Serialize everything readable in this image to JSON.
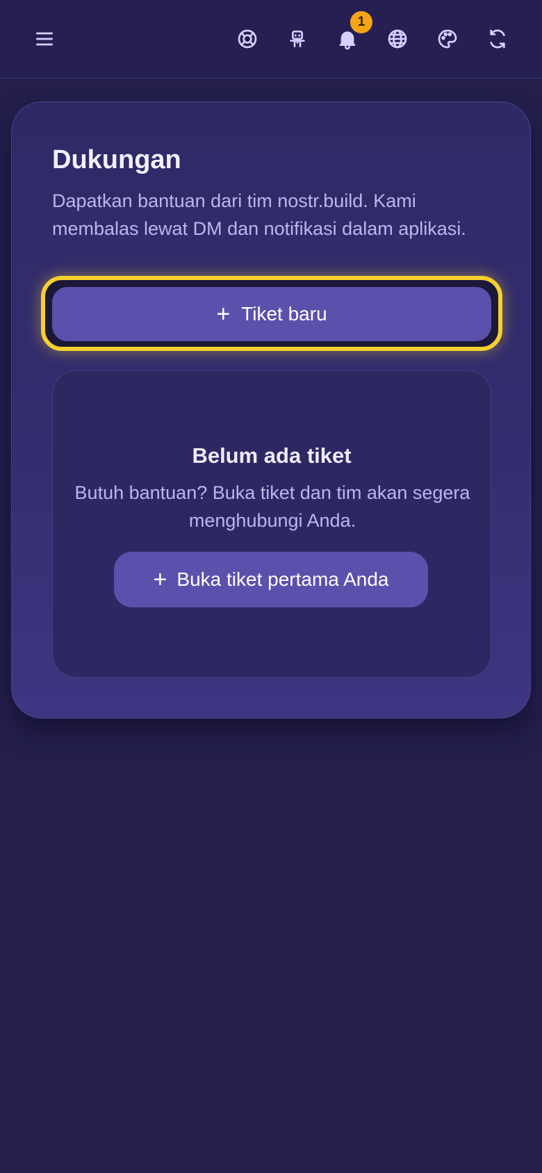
{
  "header": {
    "menu_icon": "hamburger-menu-icon",
    "icons": [
      "lifebuoy-icon",
      "robot-icon",
      "bell-icon",
      "globe-icon",
      "palette-icon",
      "refresh-icon"
    ],
    "notification_count": "1"
  },
  "support": {
    "title": "Dukungan",
    "description": "Dapatkan bantuan dari tim nostr.build. Kami membalas lewat DM dan notifikasi dalam aplikasi.",
    "new_ticket_label": "Tiket baru",
    "plus_glyph": "+",
    "empty_state": {
      "title": "Belum ada tiket",
      "subtitle": "Butuh bantuan? Buka tiket dan tim akan segera menghubungi Anda.",
      "button_label": "Buka tiket pertama Anda"
    }
  },
  "colors": {
    "background": "#241f4d",
    "accent": "#5c50ad",
    "focus_ring": "#f7cf2e",
    "badge": "#f5a516"
  }
}
